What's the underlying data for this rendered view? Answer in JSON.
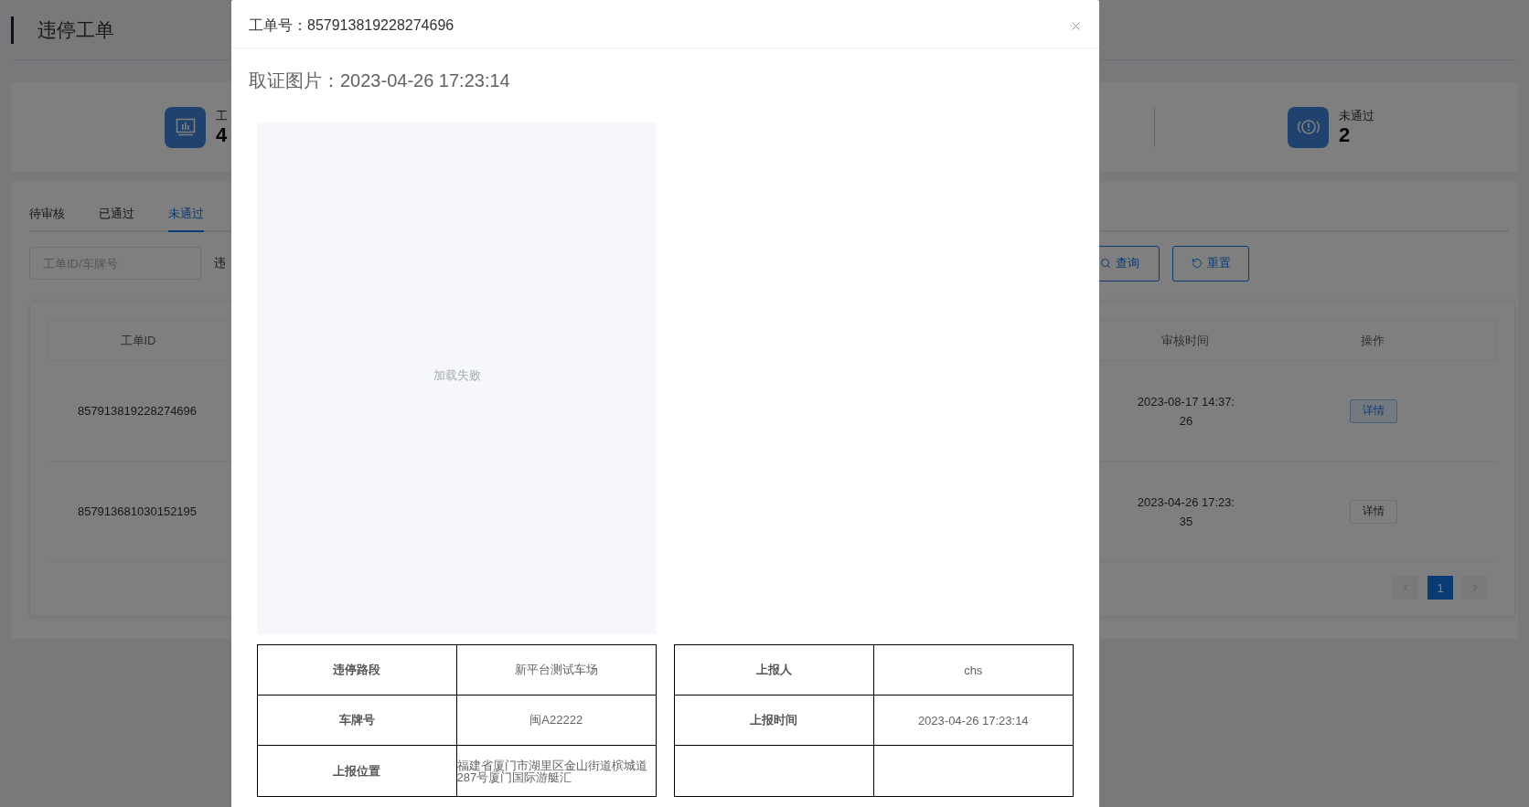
{
  "page": {
    "title": "违停工单"
  },
  "stats": [
    {
      "kind": "chart",
      "label": "工",
      "value": "4"
    },
    {
      "kind": "alert",
      "label": "未通过",
      "value": "2"
    }
  ],
  "tabs": [
    {
      "label": "待审核",
      "selected": false
    },
    {
      "label": "已通过",
      "selected": false
    },
    {
      "label": "未通过",
      "selected": true
    }
  ],
  "filters": {
    "search": {
      "placeholder": "工单ID/车牌号"
    },
    "label": "违",
    "buttons": [
      {
        "kind": "search",
        "label": "查询"
      },
      {
        "kind": "reset",
        "label": "重置"
      }
    ]
  },
  "table": {
    "columns": [
      "工单ID",
      "审核时间",
      "操作"
    ],
    "rows": [
      {
        "id": "857913819228274696",
        "review_time": "2023-08-17 14:37:26",
        "action": "详情",
        "active": true
      },
      {
        "id": "857913681030152195",
        "review_time": "2023-04-26 17:23:35",
        "action": "详情",
        "active": false
      }
    ]
  },
  "pagination": {
    "pages": [
      {
        "label": "1",
        "selected": true
      }
    ]
  },
  "modal": {
    "title": "工单号：857913819228274696",
    "evidence": {
      "heading": "取证图片：2023-04-26 17:23:14",
      "status_text": "加载失败"
    },
    "info_tables": [
      {
        "rows": [
          {
            "label": "违停路段",
            "value": "新平台测试车场"
          },
          {
            "label": "车牌号",
            "value": "闽A22222"
          },
          {
            "label": "上报位置",
            "value": "福建省厦门市湖里区金山街道槟城道287号厦门国际游艇汇",
            "kind": "address"
          }
        ]
      },
      {
        "rows": [
          {
            "label": "上报人",
            "value": "chs"
          },
          {
            "label": "上报时间",
            "value": "2023-04-26 17:23:14"
          },
          {}
        ]
      }
    ]
  }
}
